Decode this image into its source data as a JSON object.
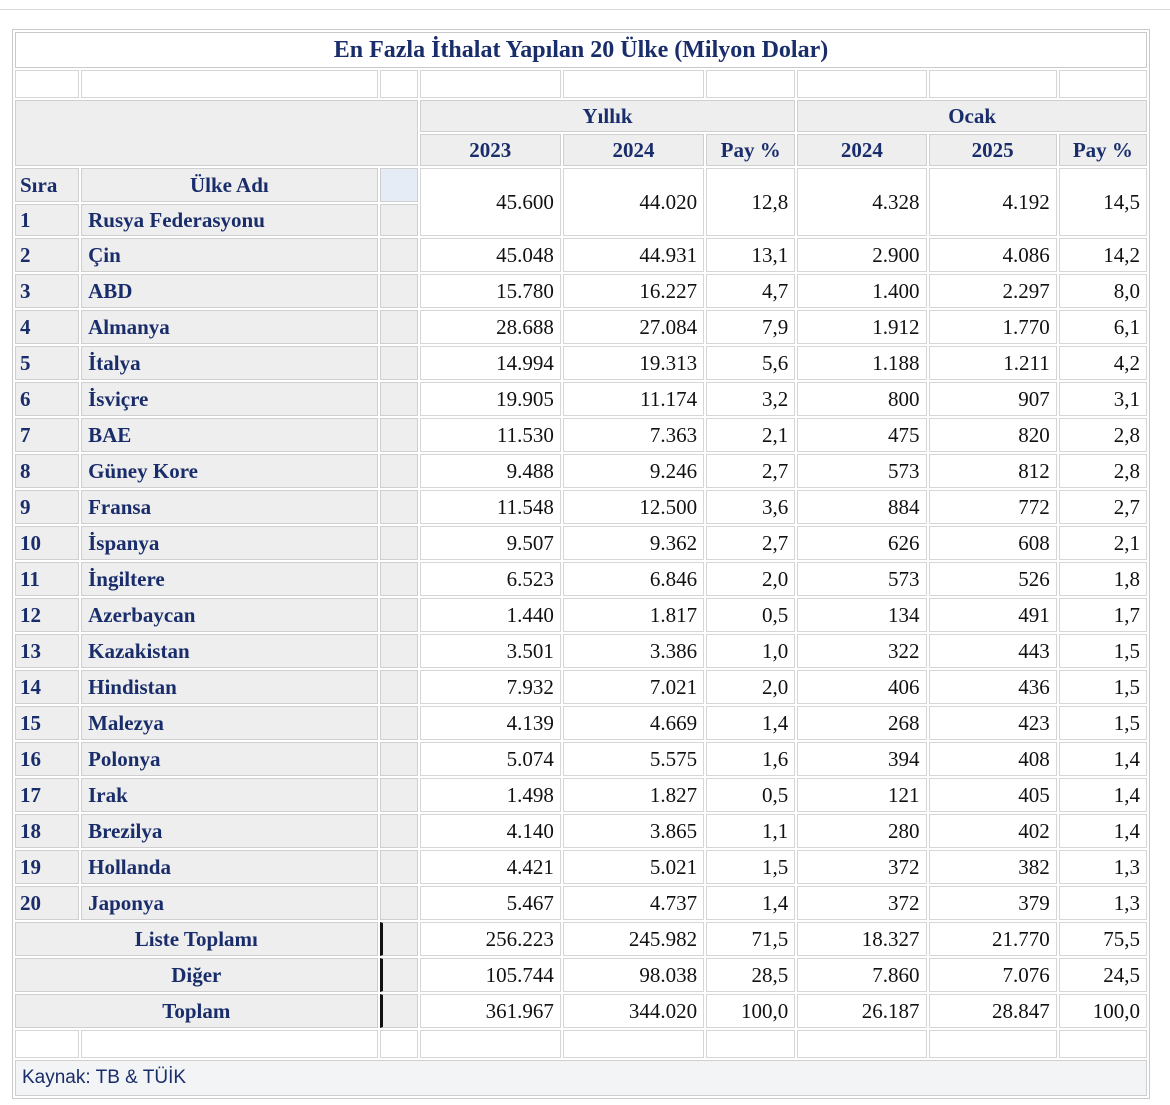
{
  "table": {
    "title": "En Fazla İthalat Yapılan 20 Ülke (Milyon Dolar)",
    "group_annual": "Yıllık",
    "group_january": "Ocak",
    "col_2023": "2023",
    "col_2024": "2024",
    "col_share": "Pay %",
    "col_jan_2024": "2024",
    "col_jan_2025": "2025",
    "col_jan_share": "Pay %",
    "col_rank": "Sıra",
    "col_country": "Ülke Adı",
    "rows": [
      {
        "rank": "1",
        "country": "Rusya Federasyonu",
        "y2023": "45.600",
        "y2024": "44.020",
        "share": "12,8",
        "j2024": "4.328",
        "j2025": "4.192",
        "jshare": "14,5"
      },
      {
        "rank": "2",
        "country": "Çin",
        "y2023": "45.048",
        "y2024": "44.931",
        "share": "13,1",
        "j2024": "2.900",
        "j2025": "4.086",
        "jshare": "14,2"
      },
      {
        "rank": "3",
        "country": "ABD",
        "y2023": "15.780",
        "y2024": "16.227",
        "share": "4,7",
        "j2024": "1.400",
        "j2025": "2.297",
        "jshare": "8,0"
      },
      {
        "rank": "4",
        "country": "Almanya",
        "y2023": "28.688",
        "y2024": "27.084",
        "share": "7,9",
        "j2024": "1.912",
        "j2025": "1.770",
        "jshare": "6,1"
      },
      {
        "rank": "5",
        "country": "İtalya",
        "y2023": "14.994",
        "y2024": "19.313",
        "share": "5,6",
        "j2024": "1.188",
        "j2025": "1.211",
        "jshare": "4,2"
      },
      {
        "rank": "6",
        "country": "İsviçre",
        "y2023": "19.905",
        "y2024": "11.174",
        "share": "3,2",
        "j2024": "800",
        "j2025": "907",
        "jshare": "3,1"
      },
      {
        "rank": "7",
        "country": "BAE",
        "y2023": "11.530",
        "y2024": "7.363",
        "share": "2,1",
        "j2024": "475",
        "j2025": "820",
        "jshare": "2,8"
      },
      {
        "rank": "8",
        "country": "Güney Kore",
        "y2023": "9.488",
        "y2024": "9.246",
        "share": "2,7",
        "j2024": "573",
        "j2025": "812",
        "jshare": "2,8"
      },
      {
        "rank": "9",
        "country": "Fransa",
        "y2023": "11.548",
        "y2024": "12.500",
        "share": "3,6",
        "j2024": "884",
        "j2025": "772",
        "jshare": "2,7"
      },
      {
        "rank": "10",
        "country": "İspanya",
        "y2023": "9.507",
        "y2024": "9.362",
        "share": "2,7",
        "j2024": "626",
        "j2025": "608",
        "jshare": "2,1"
      },
      {
        "rank": "11",
        "country": "İngiltere",
        "y2023": "6.523",
        "y2024": "6.846",
        "share": "2,0",
        "j2024": "573",
        "j2025": "526",
        "jshare": "1,8"
      },
      {
        "rank": "12",
        "country": "Azerbaycan",
        "y2023": "1.440",
        "y2024": "1.817",
        "share": "0,5",
        "j2024": "134",
        "j2025": "491",
        "jshare": "1,7"
      },
      {
        "rank": "13",
        "country": "Kazakistan",
        "y2023": "3.501",
        "y2024": "3.386",
        "share": "1,0",
        "j2024": "322",
        "j2025": "443",
        "jshare": "1,5"
      },
      {
        "rank": "14",
        "country": "Hindistan",
        "y2023": "7.932",
        "y2024": "7.021",
        "share": "2,0",
        "j2024": "406",
        "j2025": "436",
        "jshare": "1,5"
      },
      {
        "rank": "15",
        "country": "Malezya",
        "y2023": "4.139",
        "y2024": "4.669",
        "share": "1,4",
        "j2024": "268",
        "j2025": "423",
        "jshare": "1,5"
      },
      {
        "rank": "16",
        "country": "Polonya",
        "y2023": "5.074",
        "y2024": "5.575",
        "share": "1,6",
        "j2024": "394",
        "j2025": "408",
        "jshare": "1,4"
      },
      {
        "rank": "17",
        "country": "Irak",
        "y2023": "1.498",
        "y2024": "1.827",
        "share": "0,5",
        "j2024": "121",
        "j2025": "405",
        "jshare": "1,4"
      },
      {
        "rank": "18",
        "country": "Brezilya",
        "y2023": "4.140",
        "y2024": "3.865",
        "share": "1,1",
        "j2024": "280",
        "j2025": "402",
        "jshare": "1,4"
      },
      {
        "rank": "19",
        "country": "Hollanda",
        "y2023": "4.421",
        "y2024": "5.021",
        "share": "1,5",
        "j2024": "372",
        "j2025": "382",
        "jshare": "1,3"
      },
      {
        "rank": "20",
        "country": "Japonya",
        "y2023": "5.467",
        "y2024": "4.737",
        "share": "1,4",
        "j2024": "372",
        "j2025": "379",
        "jshare": "1,3"
      }
    ],
    "summary": [
      {
        "label": "Liste Toplamı",
        "y2023": "256.223",
        "y2024": "245.982",
        "share": "71,5",
        "j2024": "18.327",
        "j2025": "21.770",
        "jshare": "75,5"
      },
      {
        "label": "Diğer",
        "y2023": "105.744",
        "y2024": "98.038",
        "share": "28,5",
        "j2024": "7.860",
        "j2025": "7.076",
        "jshare": "24,5"
      },
      {
        "label": "Toplam",
        "y2023": "361.967",
        "y2024": "344.020",
        "share": "100,0",
        "j2024": "26.187",
        "j2025": "28.847",
        "jshare": "100,0"
      }
    ],
    "source": "Kaynak: TB & TÜİK"
  }
}
